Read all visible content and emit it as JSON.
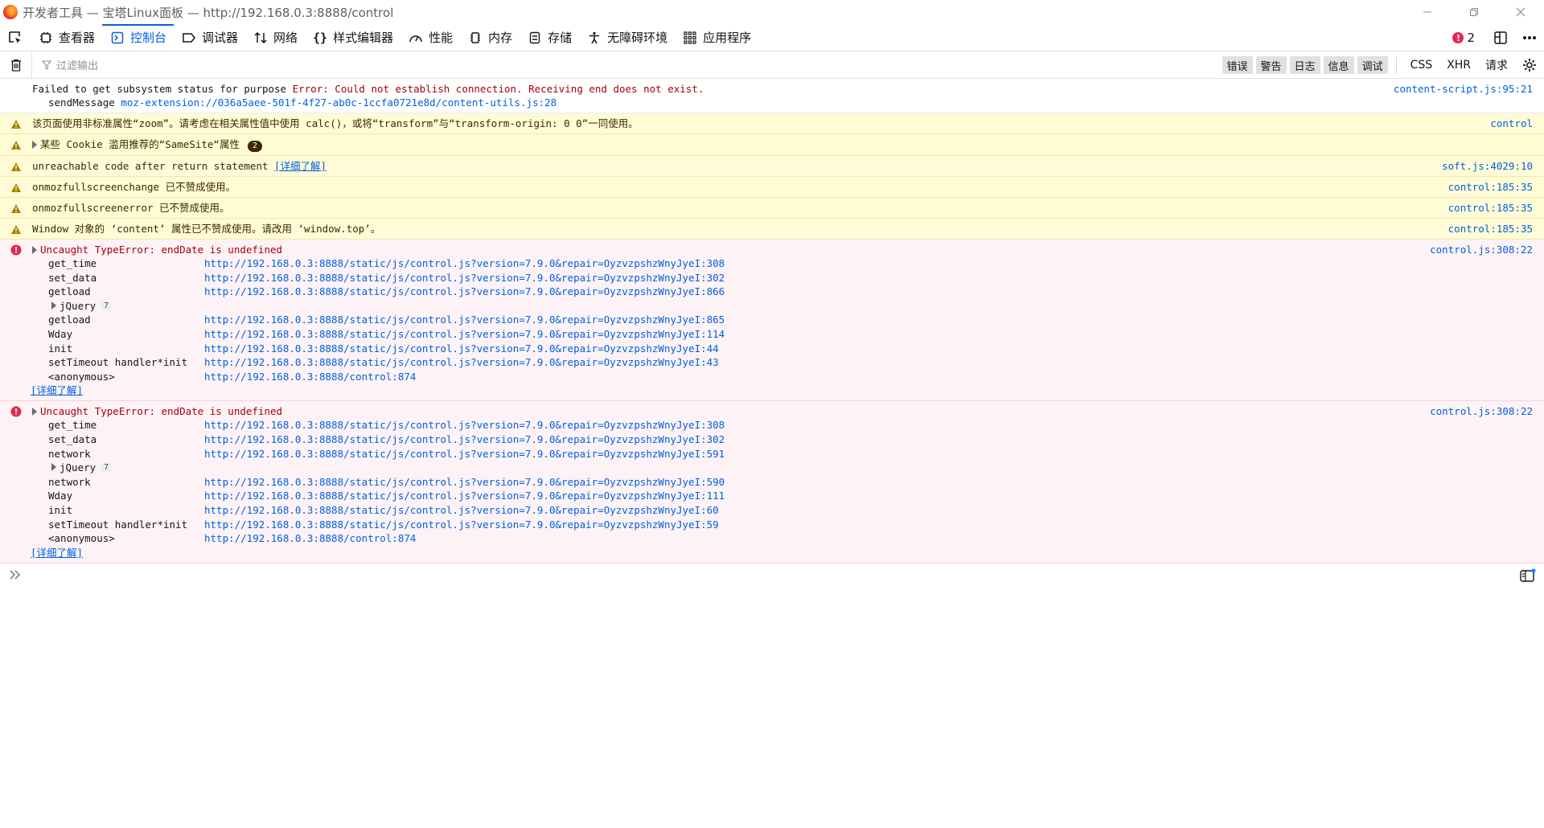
{
  "window": {
    "title": "开发者工具 — 宝塔Linux面板 — http://192.168.0.3:8888/control"
  },
  "toolbox": {
    "tabs": [
      {
        "label": "查看器",
        "icon": "inspector-icon"
      },
      {
        "label": "控制台",
        "icon": "console-icon",
        "active": true
      },
      {
        "label": "调试器",
        "icon": "debugger-icon"
      },
      {
        "label": "网络",
        "icon": "network-icon"
      },
      {
        "label": "样式编辑器",
        "icon": "style-editor-icon"
      },
      {
        "label": "性能",
        "icon": "performance-icon"
      },
      {
        "label": "内存",
        "icon": "memory-icon"
      },
      {
        "label": "存储",
        "icon": "storage-icon"
      },
      {
        "label": "无障碍环境",
        "icon": "accessibility-icon"
      },
      {
        "label": "应用程序",
        "icon": "application-icon"
      }
    ],
    "error_count": "2"
  },
  "filter": {
    "placeholder": "过滤输出",
    "levels": [
      "错误",
      "警告",
      "日志",
      "信息",
      "调试"
    ],
    "categories": [
      "CSS",
      "XHR",
      "请求"
    ]
  },
  "messages": {
    "m0": {
      "text": "Failed to get subsystem status for purpose ",
      "error": "Error: Could not establish connection. Receiving end does not exist.",
      "fn": "sendMessage",
      "link": "moz-extension://036a5aee-501f-4f27-ab0c-1ccfa0721e8d/content-utils.js:28",
      "source": "content-script.js:95:21"
    },
    "m1": {
      "text": "该页面使用非标准属性“zoom”。请考虑在相关属性值中使用 calc()，或将“transform”与“transform-origin: 0 0”一同使用。",
      "source": "control"
    },
    "m2": {
      "text": "某些 Cookie 滥用推荐的“SameSite“属性",
      "badge": "2"
    },
    "m3": {
      "text": "unreachable code after return statement ",
      "learn": "[详细了解]",
      "source": "soft.js:4029:10"
    },
    "m4": {
      "text": "onmozfullscreenchange 已不赞成使用。",
      "source": "control:185:35"
    },
    "m5": {
      "text": "onmozfullscreenerror 已不赞成使用。",
      "source": "control:185:35"
    },
    "m6": {
      "text": "Window 对象的 ‘content’ 属性已不赞成使用。请改用 ‘window.top’。",
      "source": "control:185:35"
    },
    "e1": {
      "text": "Uncaught TypeError: endDate is undefined",
      "source": "control.js:308:22",
      "frames": [
        {
          "fn": "get_time",
          "url": "http://192.168.0.3:8888/static/js/control.js?version=7.9.0&repair=OyzvzpshzWnyJyeI:308"
        },
        {
          "fn": "set_data",
          "url": "http://192.168.0.3:8888/static/js/control.js?version=7.9.0&repair=OyzvzpshzWnyJyeI:302"
        },
        {
          "fn": "getload",
          "url": "http://192.168.0.3:8888/static/js/control.js?version=7.9.0&repair=OyzvzpshzWnyJyeI:866"
        }
      ],
      "group": {
        "name": "jQuery",
        "count": "7"
      },
      "frames2": [
        {
          "fn": "getload",
          "url": "http://192.168.0.3:8888/static/js/control.js?version=7.9.0&repair=OyzvzpshzWnyJyeI:865"
        },
        {
          "fn": "Wday",
          "url": "http://192.168.0.3:8888/static/js/control.js?version=7.9.0&repair=OyzvzpshzWnyJyeI:114"
        },
        {
          "fn": "init",
          "url": "http://192.168.0.3:8888/static/js/control.js?version=7.9.0&repair=OyzvzpshzWnyJyeI:44"
        },
        {
          "fn": "setTimeout handler*init",
          "url": "http://192.168.0.3:8888/static/js/control.js?version=7.9.0&repair=OyzvzpshzWnyJyeI:43"
        },
        {
          "fn": "<anonymous>",
          "url": "http://192.168.0.3:8888/control:874"
        }
      ],
      "learn": "[详细了解]"
    },
    "e2": {
      "text": "Uncaught TypeError: endDate is undefined",
      "source": "control.js:308:22",
      "frames": [
        {
          "fn": "get_time",
          "url": "http://192.168.0.3:8888/static/js/control.js?version=7.9.0&repair=OyzvzpshzWnyJyeI:308"
        },
        {
          "fn": "set_data",
          "url": "http://192.168.0.3:8888/static/js/control.js?version=7.9.0&repair=OyzvzpshzWnyJyeI:302"
        },
        {
          "fn": "network",
          "url": "http://192.168.0.3:8888/static/js/control.js?version=7.9.0&repair=OyzvzpshzWnyJyeI:591"
        }
      ],
      "group": {
        "name": "jQuery",
        "count": "7"
      },
      "frames2": [
        {
          "fn": "network",
          "url": "http://192.168.0.3:8888/static/js/control.js?version=7.9.0&repair=OyzvzpshzWnyJyeI:590"
        },
        {
          "fn": "Wday",
          "url": "http://192.168.0.3:8888/static/js/control.js?version=7.9.0&repair=OyzvzpshzWnyJyeI:111"
        },
        {
          "fn": "init",
          "url": "http://192.168.0.3:8888/static/js/control.js?version=7.9.0&repair=OyzvzpshzWnyJyeI:60"
        },
        {
          "fn": "setTimeout handler*init",
          "url": "http://192.168.0.3:8888/static/js/control.js?version=7.9.0&repair=OyzvzpshzWnyJyeI:59"
        },
        {
          "fn": "<anonymous>",
          "url": "http://192.168.0.3:8888/control:874"
        }
      ],
      "learn": "[详细了解]"
    }
  },
  "colors": {
    "accent": "#0061e0",
    "warning_bg": "#fffbd6",
    "error_bg": "#fdf2f5",
    "error_text": "#a4000f"
  }
}
